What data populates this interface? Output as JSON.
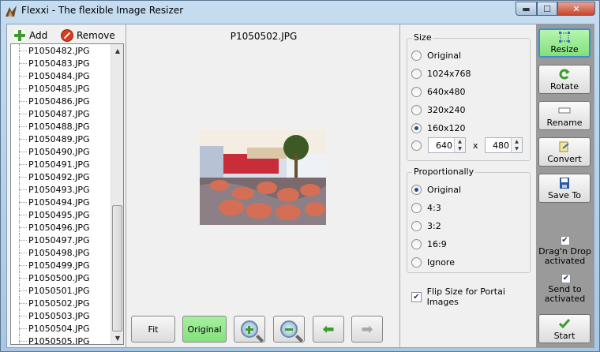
{
  "window": {
    "title": "Flexxi - The flexible Image Resizer",
    "controls": {
      "minimize": "▬",
      "maximize": "☐",
      "close": "✕"
    }
  },
  "toolbar": {
    "add_label": "Add",
    "remove_label": "Remove"
  },
  "files": [
    "P1050482.JPG",
    "P1050483.JPG",
    "P1050484.JPG",
    "P1050485.JPG",
    "P1050486.JPG",
    "P1050487.JPG",
    "P1050488.JPG",
    "P1050489.JPG",
    "P1050490.JPG",
    "P1050491.JPG",
    "P1050492.JPG",
    "P1050493.JPG",
    "P1050494.JPG",
    "P1050495.JPG",
    "P1050496.JPG",
    "P1050497.JPG",
    "P1050498.JPG",
    "P1050499.JPG",
    "P1050500.JPG",
    "P1050501.JPG",
    "P1050502.JPG",
    "P1050503.JPG",
    "P1050504.JPG",
    "P1050505.JPG"
  ],
  "preview": {
    "filename": "P1050502.JPG",
    "buttons": {
      "fit": "Fit",
      "original": "Original"
    }
  },
  "size_group": {
    "title": "Size",
    "options": [
      "Original",
      "1024x768",
      "640x480",
      "320x240",
      "160x120"
    ],
    "selected": "160x120",
    "custom_width": "640",
    "custom_x": "x",
    "custom_height": "480"
  },
  "proportion_group": {
    "title": "Proportionally",
    "options": [
      "Original",
      "4:3",
      "3:2",
      "16:9",
      "Ignore"
    ],
    "selected": "Original"
  },
  "flip_option": {
    "label": "Flip Size for Portai Images",
    "checked": true
  },
  "actions": {
    "resize": "Resize",
    "rotate": "Rotate",
    "rename": "Rename",
    "convert": "Convert",
    "save_to": "Save To",
    "dragdrop_line1": "Drag'n Drop",
    "dragdrop_line2": "activated",
    "sendto_line1": "Send to",
    "sendto_line2": "activated",
    "start": "Start"
  },
  "colors": {
    "active_green": "#86e07e",
    "accent_blue": "#3b8fd3"
  }
}
